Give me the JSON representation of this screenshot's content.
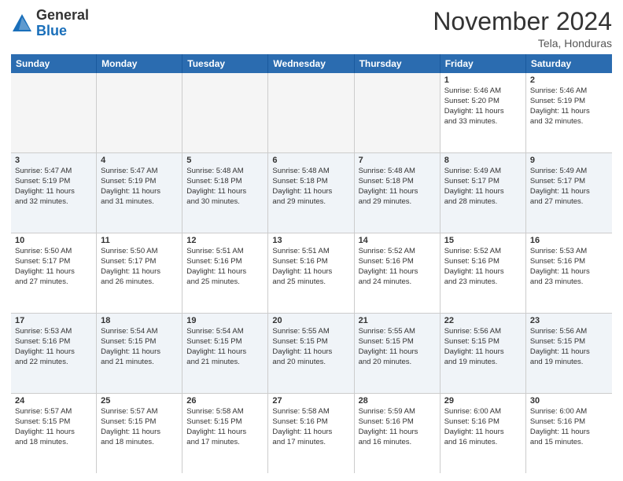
{
  "logo": {
    "general": "General",
    "blue": "Blue"
  },
  "title": "November 2024",
  "location": "Tela, Honduras",
  "days": [
    "Sunday",
    "Monday",
    "Tuesday",
    "Wednesday",
    "Thursday",
    "Friday",
    "Saturday"
  ],
  "weeks": [
    [
      {
        "day": "",
        "empty": true
      },
      {
        "day": "",
        "empty": true
      },
      {
        "day": "",
        "empty": true
      },
      {
        "day": "",
        "empty": true
      },
      {
        "day": "",
        "empty": true
      },
      {
        "day": "1",
        "l1": "Sunrise: 5:46 AM",
        "l2": "Sunset: 5:20 PM",
        "l3": "Daylight: 11 hours",
        "l4": "and 33 minutes."
      },
      {
        "day": "2",
        "l1": "Sunrise: 5:46 AM",
        "l2": "Sunset: 5:19 PM",
        "l3": "Daylight: 11 hours",
        "l4": "and 32 minutes."
      }
    ],
    [
      {
        "day": "3",
        "l1": "Sunrise: 5:47 AM",
        "l2": "Sunset: 5:19 PM",
        "l3": "Daylight: 11 hours",
        "l4": "and 32 minutes."
      },
      {
        "day": "4",
        "l1": "Sunrise: 5:47 AM",
        "l2": "Sunset: 5:19 PM",
        "l3": "Daylight: 11 hours",
        "l4": "and 31 minutes."
      },
      {
        "day": "5",
        "l1": "Sunrise: 5:48 AM",
        "l2": "Sunset: 5:18 PM",
        "l3": "Daylight: 11 hours",
        "l4": "and 30 minutes."
      },
      {
        "day": "6",
        "l1": "Sunrise: 5:48 AM",
        "l2": "Sunset: 5:18 PM",
        "l3": "Daylight: 11 hours",
        "l4": "and 29 minutes."
      },
      {
        "day": "7",
        "l1": "Sunrise: 5:48 AM",
        "l2": "Sunset: 5:18 PM",
        "l3": "Daylight: 11 hours",
        "l4": "and 29 minutes."
      },
      {
        "day": "8",
        "l1": "Sunrise: 5:49 AM",
        "l2": "Sunset: 5:17 PM",
        "l3": "Daylight: 11 hours",
        "l4": "and 28 minutes."
      },
      {
        "day": "9",
        "l1": "Sunrise: 5:49 AM",
        "l2": "Sunset: 5:17 PM",
        "l3": "Daylight: 11 hours",
        "l4": "and 27 minutes."
      }
    ],
    [
      {
        "day": "10",
        "l1": "Sunrise: 5:50 AM",
        "l2": "Sunset: 5:17 PM",
        "l3": "Daylight: 11 hours",
        "l4": "and 27 minutes."
      },
      {
        "day": "11",
        "l1": "Sunrise: 5:50 AM",
        "l2": "Sunset: 5:17 PM",
        "l3": "Daylight: 11 hours",
        "l4": "and 26 minutes."
      },
      {
        "day": "12",
        "l1": "Sunrise: 5:51 AM",
        "l2": "Sunset: 5:16 PM",
        "l3": "Daylight: 11 hours",
        "l4": "and 25 minutes."
      },
      {
        "day": "13",
        "l1": "Sunrise: 5:51 AM",
        "l2": "Sunset: 5:16 PM",
        "l3": "Daylight: 11 hours",
        "l4": "and 25 minutes."
      },
      {
        "day": "14",
        "l1": "Sunrise: 5:52 AM",
        "l2": "Sunset: 5:16 PM",
        "l3": "Daylight: 11 hours",
        "l4": "and 24 minutes."
      },
      {
        "day": "15",
        "l1": "Sunrise: 5:52 AM",
        "l2": "Sunset: 5:16 PM",
        "l3": "Daylight: 11 hours",
        "l4": "and 23 minutes."
      },
      {
        "day": "16",
        "l1": "Sunrise: 5:53 AM",
        "l2": "Sunset: 5:16 PM",
        "l3": "Daylight: 11 hours",
        "l4": "and 23 minutes."
      }
    ],
    [
      {
        "day": "17",
        "l1": "Sunrise: 5:53 AM",
        "l2": "Sunset: 5:16 PM",
        "l3": "Daylight: 11 hours",
        "l4": "and 22 minutes."
      },
      {
        "day": "18",
        "l1": "Sunrise: 5:54 AM",
        "l2": "Sunset: 5:15 PM",
        "l3": "Daylight: 11 hours",
        "l4": "and 21 minutes."
      },
      {
        "day": "19",
        "l1": "Sunrise: 5:54 AM",
        "l2": "Sunset: 5:15 PM",
        "l3": "Daylight: 11 hours",
        "l4": "and 21 minutes."
      },
      {
        "day": "20",
        "l1": "Sunrise: 5:55 AM",
        "l2": "Sunset: 5:15 PM",
        "l3": "Daylight: 11 hours",
        "l4": "and 20 minutes."
      },
      {
        "day": "21",
        "l1": "Sunrise: 5:55 AM",
        "l2": "Sunset: 5:15 PM",
        "l3": "Daylight: 11 hours",
        "l4": "and 20 minutes."
      },
      {
        "day": "22",
        "l1": "Sunrise: 5:56 AM",
        "l2": "Sunset: 5:15 PM",
        "l3": "Daylight: 11 hours",
        "l4": "and 19 minutes."
      },
      {
        "day": "23",
        "l1": "Sunrise: 5:56 AM",
        "l2": "Sunset: 5:15 PM",
        "l3": "Daylight: 11 hours",
        "l4": "and 19 minutes."
      }
    ],
    [
      {
        "day": "24",
        "l1": "Sunrise: 5:57 AM",
        "l2": "Sunset: 5:15 PM",
        "l3": "Daylight: 11 hours",
        "l4": "and 18 minutes."
      },
      {
        "day": "25",
        "l1": "Sunrise: 5:57 AM",
        "l2": "Sunset: 5:15 PM",
        "l3": "Daylight: 11 hours",
        "l4": "and 18 minutes."
      },
      {
        "day": "26",
        "l1": "Sunrise: 5:58 AM",
        "l2": "Sunset: 5:15 PM",
        "l3": "Daylight: 11 hours",
        "l4": "and 17 minutes."
      },
      {
        "day": "27",
        "l1": "Sunrise: 5:58 AM",
        "l2": "Sunset: 5:16 PM",
        "l3": "Daylight: 11 hours",
        "l4": "and 17 minutes."
      },
      {
        "day": "28",
        "l1": "Sunrise: 5:59 AM",
        "l2": "Sunset: 5:16 PM",
        "l3": "Daylight: 11 hours",
        "l4": "and 16 minutes."
      },
      {
        "day": "29",
        "l1": "Sunrise: 6:00 AM",
        "l2": "Sunset: 5:16 PM",
        "l3": "Daylight: 11 hours",
        "l4": "and 16 minutes."
      },
      {
        "day": "30",
        "l1": "Sunrise: 6:00 AM",
        "l2": "Sunset: 5:16 PM",
        "l3": "Daylight: 11 hours",
        "l4": "and 15 minutes."
      }
    ]
  ]
}
